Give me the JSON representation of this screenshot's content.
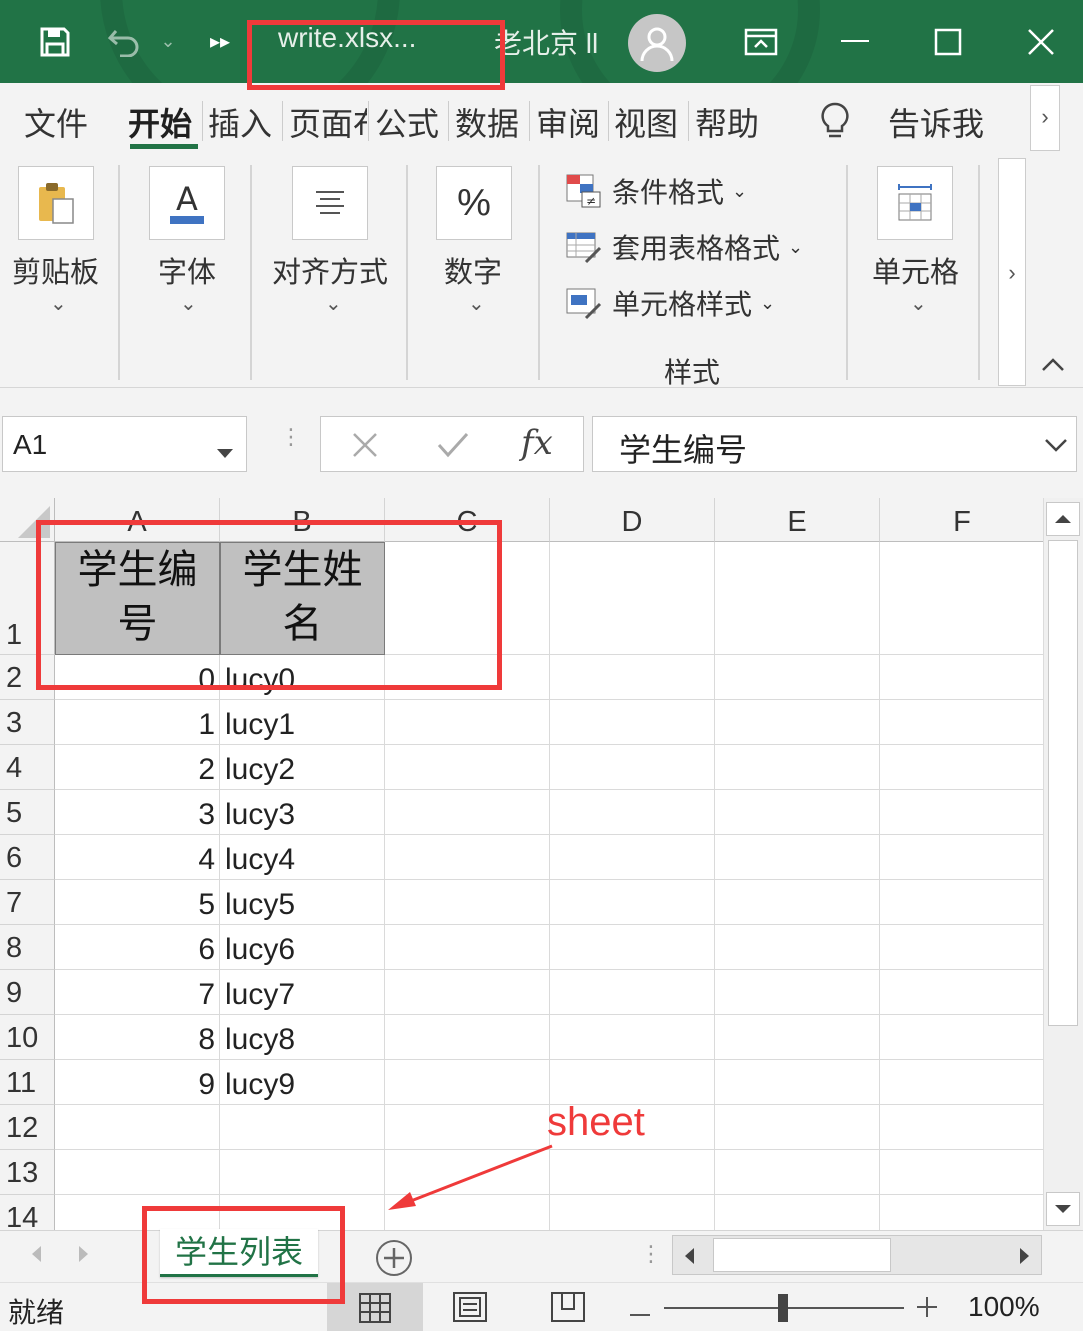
{
  "window": {
    "title": "write.xlsx...",
    "user": "老北京 ll"
  },
  "ribbon_tabs": [
    {
      "label": "文件"
    },
    {
      "label": "开始"
    },
    {
      "label": "插入"
    },
    {
      "label": "页面布"
    },
    {
      "label": "公式"
    },
    {
      "label": "数据"
    },
    {
      "label": "审阅"
    },
    {
      "label": "视图"
    },
    {
      "label": "帮助"
    }
  ],
  "tell_me": "告诉我",
  "ribbon_groups": {
    "clipboard": "剪贴板",
    "font": "字体",
    "alignment": "对齐方式",
    "number": "数字",
    "number_icon": "%",
    "styles": "样式",
    "cells": "单元格",
    "conditional_format": "条件格式",
    "format_as_table": "套用表格格式",
    "cell_styles": "单元格样式"
  },
  "formula_bar": {
    "name_box": "A1",
    "fx": "fx",
    "value": "学生编号"
  },
  "columns": [
    "A",
    "B",
    "C",
    "D",
    "E",
    "F"
  ],
  "rows": [
    "1",
    "2",
    "3",
    "4",
    "5",
    "6",
    "7",
    "8",
    "9",
    "10",
    "11",
    "12",
    "13",
    "14"
  ],
  "header_row": [
    "学生编号",
    "学生姓名"
  ],
  "header_row_lines": [
    [
      "学生编",
      "号"
    ],
    [
      "学生姓",
      "名"
    ]
  ],
  "data_rows": [
    {
      "id": "0",
      "name": "lucy0"
    },
    {
      "id": "1",
      "name": "lucy1"
    },
    {
      "id": "2",
      "name": "lucy2"
    },
    {
      "id": "3",
      "name": "lucy3"
    },
    {
      "id": "4",
      "name": "lucy4"
    },
    {
      "id": "5",
      "name": "lucy5"
    },
    {
      "id": "6",
      "name": "lucy6"
    },
    {
      "id": "7",
      "name": "lucy7"
    },
    {
      "id": "8",
      "name": "lucy8"
    },
    {
      "id": "9",
      "name": "lucy9"
    }
  ],
  "sheet_tab": "学生列表",
  "status": {
    "ready": "就绪",
    "zoom": "100%"
  },
  "annotation": "sheet",
  "colors": {
    "brand": "#217346",
    "annotation": "#ef3a3a",
    "header_fill": "#c0c0c0"
  }
}
